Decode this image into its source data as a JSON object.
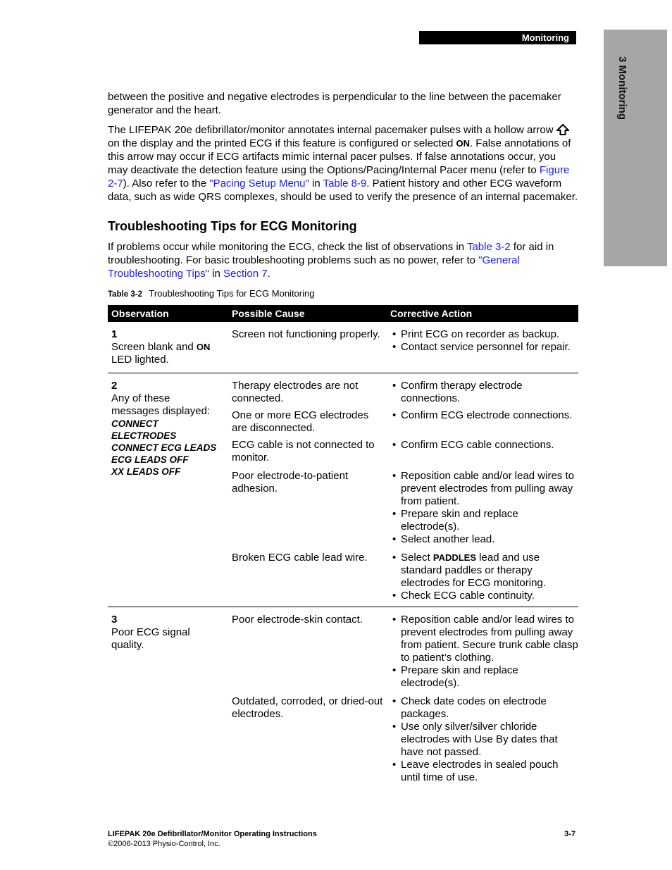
{
  "header": {
    "section_label": "Monitoring"
  },
  "side_tab": {
    "label": "3 Monitoring"
  },
  "intro": {
    "para1": "between the positive and negative electrodes is perpendicular to the line between the pacemaker generator and the heart.",
    "para2": {
      "t1": "The LIFEPAK 20e defibrillator/monitor annotates internal pacemaker pulses with a hollow arrow ",
      "icon": "hollow-up-arrow-icon",
      "t2": " on the display and the printed ECG if this feature is configured or selected ",
      "on": "ON",
      "t3": ". False annotations of this arrow may occur if ECG artifacts mimic internal pacer pulses. If false annotations occur, you may deactivate the detection feature using the Options/Pacing/Internal Pacer menu (refer to ",
      "link1": "Figure 2-7",
      "t4": "). Also refer to the ",
      "link2": "\"Pacing Setup Menu\"",
      "t5": " in ",
      "link3": "Table 8-9",
      "t6": ". Patient history and other ECG waveform data, such as wide QRS complexes, should be used to verify the presence of an internal pacemaker."
    }
  },
  "section": {
    "heading": "Troubleshooting Tips for ECG Monitoring",
    "para": {
      "t1": "If problems occur while monitoring the ECG, check the list of observations in ",
      "link1": "Table 3-2",
      "t2": " for aid in troubleshooting. For basic troubleshooting problems such as no power, refer to ",
      "link2": "\"General Troubleshooting Tips\"",
      "t3": " in ",
      "link3": "Section 7",
      "t4": "."
    }
  },
  "table": {
    "caption_num": "Table 3-2",
    "caption_title": "Troubleshooting Tips for ECG Monitoring",
    "headers": [
      "Observation",
      "Possible Cause",
      "Corrective Action"
    ],
    "rows": [
      {
        "num": "1",
        "obs_a": "Screen blank and ",
        "obs_b": "ON",
        "obs_c": " LED lighted.",
        "pairs": [
          {
            "cause": "Screen not functioning properly.",
            "actions": [
              "Print ECG on recorder as backup.",
              "Contact service personnel for repair."
            ]
          }
        ]
      },
      {
        "num": "2",
        "obs": "Any of these messages displayed:",
        "messages": [
          "CONNECT ELECTRODES",
          "CONNECT ECG LEADS",
          "ECG LEADS OFF",
          "XX LEADS OFF"
        ],
        "pairs": [
          {
            "cause": "Therapy electrodes are not connected.",
            "actions": [
              "Confirm therapy electrode connections."
            ]
          },
          {
            "cause": "One or more ECG electrodes are disconnected.",
            "actions": [
              "Confirm ECG electrode connections."
            ]
          },
          {
            "cause": "ECG cable is not connected to monitor.",
            "actions": [
              "Confirm ECG cable connections."
            ]
          },
          {
            "cause": "Poor electrode-to-patient adhesion.",
            "actions": [
              "Reposition cable and/or lead wires to prevent electrodes from pulling away from patient.",
              "Prepare skin and replace electrode(s).",
              "Select another lead."
            ]
          },
          {
            "cause": "Broken ECG cable lead wire.",
            "action_bold_pre": "Select ",
            "action_bold": "PADDLES",
            "action_bold_post": " lead and use standard paddles or therapy electrodes for ECG monitoring.",
            "actions": [
              "Check ECG cable continuity."
            ]
          }
        ]
      },
      {
        "num": "3",
        "obs": "Poor ECG signal quality.",
        "pairs": [
          {
            "cause": "Poor electrode-skin contact.",
            "actions": [
              "Reposition cable and/or lead wires to prevent electrodes from pulling away from patient. Secure trunk cable clasp to patient’s clothing.",
              "Prepare skin and replace electrode(s)."
            ]
          },
          {
            "cause": "Outdated, corroded, or dried-out electrodes.",
            "actions": [
              "Check date codes on electrode packages.",
              "Use only silver/silver chloride electrodes with Use By dates that have not passed.",
              "Leave electrodes in sealed pouch until time of use."
            ]
          }
        ]
      }
    ]
  },
  "footer": {
    "title": "LIFEPAK 20e Defibrillator/Monitor Operating Instructions",
    "copyright": "©2006-2013 Physio-Control, Inc.",
    "page": "3-7"
  }
}
